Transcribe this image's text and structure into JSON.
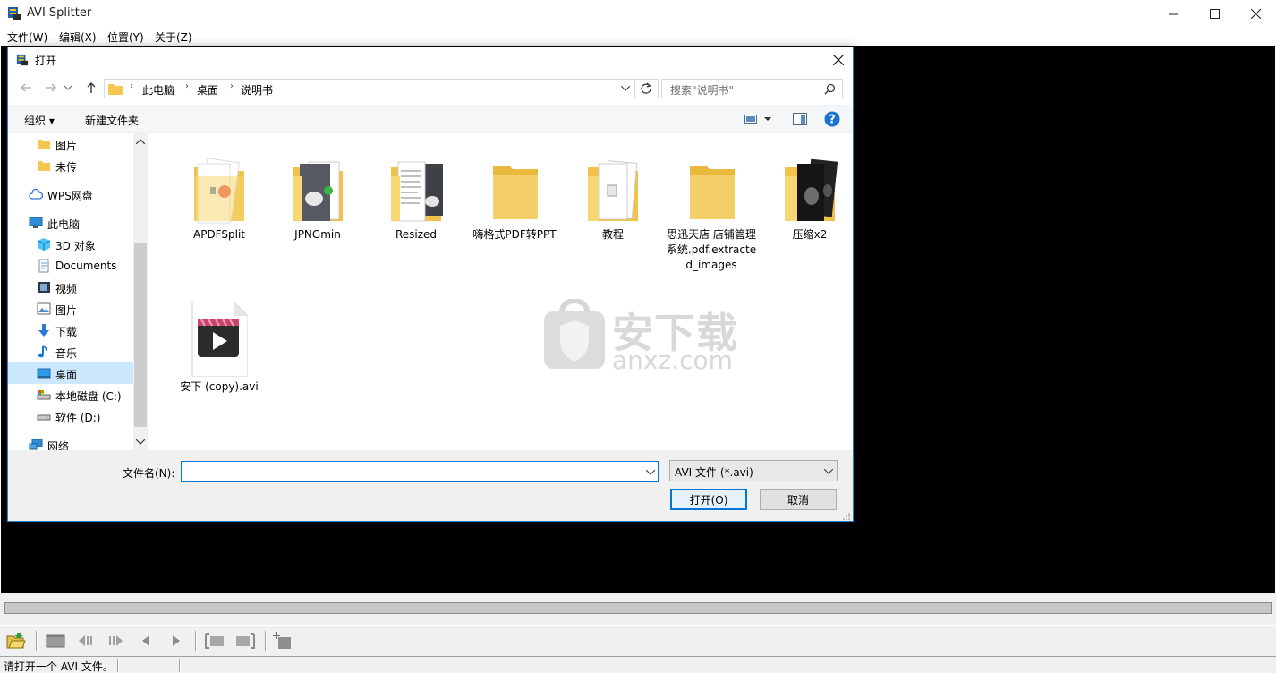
{
  "window": {
    "title": "AVI Splitter",
    "minimize": "—",
    "maximize": "☐",
    "close": "✕"
  },
  "menu": [
    "文件(W)",
    "编辑(X)",
    "位置(Y)",
    "关于(Z)"
  ],
  "dialog": {
    "title": "打开",
    "breadcrumbs": [
      "此电脑",
      "桌面",
      "说明书"
    ],
    "search_placeholder": "搜索\"说明书\"",
    "organize_label": "组织 ▾",
    "new_folder_label": "新建文件夹",
    "nav_items": [
      {
        "label": "图片",
        "icon": "folder-icon"
      },
      {
        "label": "未传",
        "icon": "folder-icon"
      },
      {
        "label": "WPS网盘",
        "icon": "cloud-icon"
      },
      {
        "label": "此电脑",
        "icon": "computer-icon"
      },
      {
        "label": "3D 对象",
        "icon": "cube-icon"
      },
      {
        "label": "Documents",
        "icon": "document-icon"
      },
      {
        "label": "视频",
        "icon": "film-icon"
      },
      {
        "label": "图片",
        "icon": "picture-icon"
      },
      {
        "label": "下载",
        "icon": "download-icon"
      },
      {
        "label": "音乐",
        "icon": "music-icon"
      },
      {
        "label": "桌面",
        "icon": "desktop-icon"
      },
      {
        "label": "本地磁盘 (C:)",
        "icon": "drive-icon"
      },
      {
        "label": "软件 (D:)",
        "icon": "drive-icon"
      },
      {
        "label": "网络",
        "icon": "network-icon"
      }
    ],
    "files": [
      {
        "name": "APDFSplit",
        "type": "folder"
      },
      {
        "name": "JPNGmin",
        "type": "folder"
      },
      {
        "name": "Resized",
        "type": "folder"
      },
      {
        "name": "嗨格式PDF转PPT",
        "type": "folder"
      },
      {
        "name": "教程",
        "type": "folder"
      },
      {
        "name": "思迅天店 店铺管理系统.pdf.extracted_images",
        "type": "folder"
      },
      {
        "name": "压缩x2",
        "type": "folder"
      },
      {
        "name": "安下 (copy).avi",
        "type": "video"
      }
    ],
    "watermark_text": "安下载",
    "watermark_domain": "anxz.com",
    "filename_label": "文件名(N):",
    "filename_value": "",
    "filetype_value": "AVI 文件 (*.avi)",
    "open_button": "打开(O)",
    "cancel_button": "取消"
  },
  "status": {
    "message": "请打开一个 AVI 文件。"
  }
}
